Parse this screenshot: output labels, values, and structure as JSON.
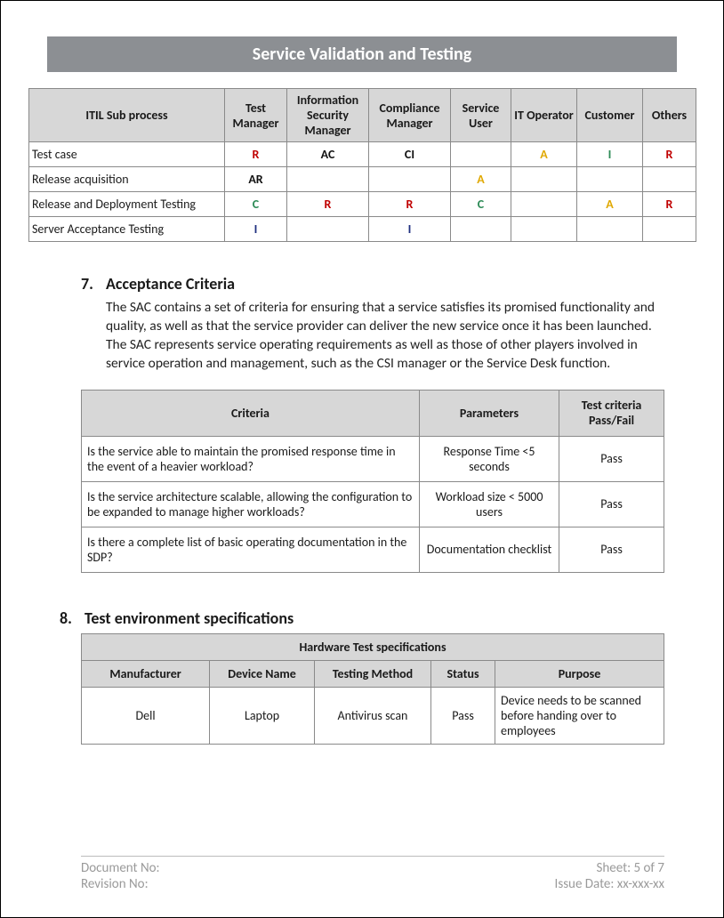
{
  "title": "Service Validation and Testing",
  "raci": {
    "headers": [
      "ITIL Sub process",
      "Test Manager",
      "Information Security Manager",
      "Compliance Manager",
      "Service User",
      "IT Operator",
      "Customer",
      "Others"
    ],
    "rows": [
      {
        "proc": "Test case",
        "cells": [
          {
            "t": "R",
            "k": "red"
          },
          {
            "t": "AC",
            "k": "black"
          },
          {
            "t": "CI",
            "k": "black"
          },
          {
            "t": "",
            "k": ""
          },
          {
            "t": "A",
            "k": "gold"
          },
          {
            "t": "I",
            "k": "green"
          },
          {
            "t": "R",
            "k": "red"
          }
        ]
      },
      {
        "proc": "Release acquisition",
        "cells": [
          {
            "t": "AR",
            "k": "black"
          },
          {
            "t": "",
            "k": ""
          },
          {
            "t": "",
            "k": ""
          },
          {
            "t": "A",
            "k": "gold"
          },
          {
            "t": "",
            "k": ""
          },
          {
            "t": "",
            "k": ""
          },
          {
            "t": "",
            "k": ""
          }
        ]
      },
      {
        "proc": "Release and Deployment Testing",
        "cells": [
          {
            "t": "C",
            "k": "green"
          },
          {
            "t": "R",
            "k": "red"
          },
          {
            "t": "R",
            "k": "red"
          },
          {
            "t": "C",
            "k": "green"
          },
          {
            "t": "",
            "k": ""
          },
          {
            "t": "A",
            "k": "gold"
          },
          {
            "t": "R",
            "k": "red"
          }
        ]
      },
      {
        "proc": "Server Acceptance Testing",
        "cells": [
          {
            "t": "I",
            "k": "navy"
          },
          {
            "t": "",
            "k": ""
          },
          {
            "t": "I",
            "k": "navy"
          },
          {
            "t": "",
            "k": ""
          },
          {
            "t": "",
            "k": ""
          },
          {
            "t": "",
            "k": ""
          },
          {
            "t": "",
            "k": ""
          }
        ]
      }
    ]
  },
  "section7": {
    "num": "7.",
    "title": "Acceptance Criteria",
    "para": "The SAC contains a set of criteria for ensuring that a service satisfies its promised functionality and quality, as well as that the service provider can deliver the new service once it has been launched. The SAC represents service operating requirements as well as those of other players involved in service operation and management, such as the CSI manager or the Service Desk function.",
    "headers": [
      "Criteria",
      "Parameters",
      "Test criteria Pass/Fail"
    ],
    "rows": [
      {
        "c1": "Is the service able to maintain the promised response time in the event of a heavier workload?",
        "c2": "Response Time <5 seconds",
        "c3": "Pass"
      },
      {
        "c1": " Is the service architecture scalable, allowing the configuration to be expanded to manage higher workloads?",
        "c2": "Workload size < 5000 users",
        "c3": "Pass"
      },
      {
        "c1": "Is there a complete list of basic operating documentation in the SDP?",
        "c2": "Documentation checklist",
        "c3": "Pass"
      }
    ]
  },
  "section8": {
    "num": "8.",
    "title": "Test environment specifications",
    "tableTitle": "Hardware Test specifications",
    "headers": [
      "Manufacturer",
      "Device Name",
      "Testing Method",
      "Status",
      "Purpose"
    ],
    "row": {
      "mfr": "Dell",
      "dev": "Laptop",
      "method": "Antivirus scan",
      "status": "Pass",
      "purpose": "Device needs to be scanned before handing over to employees"
    }
  },
  "footer": {
    "docno_label": "Document No:",
    "sheet": "Sheet: 5 of 7",
    "revno_label": "Revision No:",
    "issue": "Issue Date: xx-xxx-xx"
  }
}
